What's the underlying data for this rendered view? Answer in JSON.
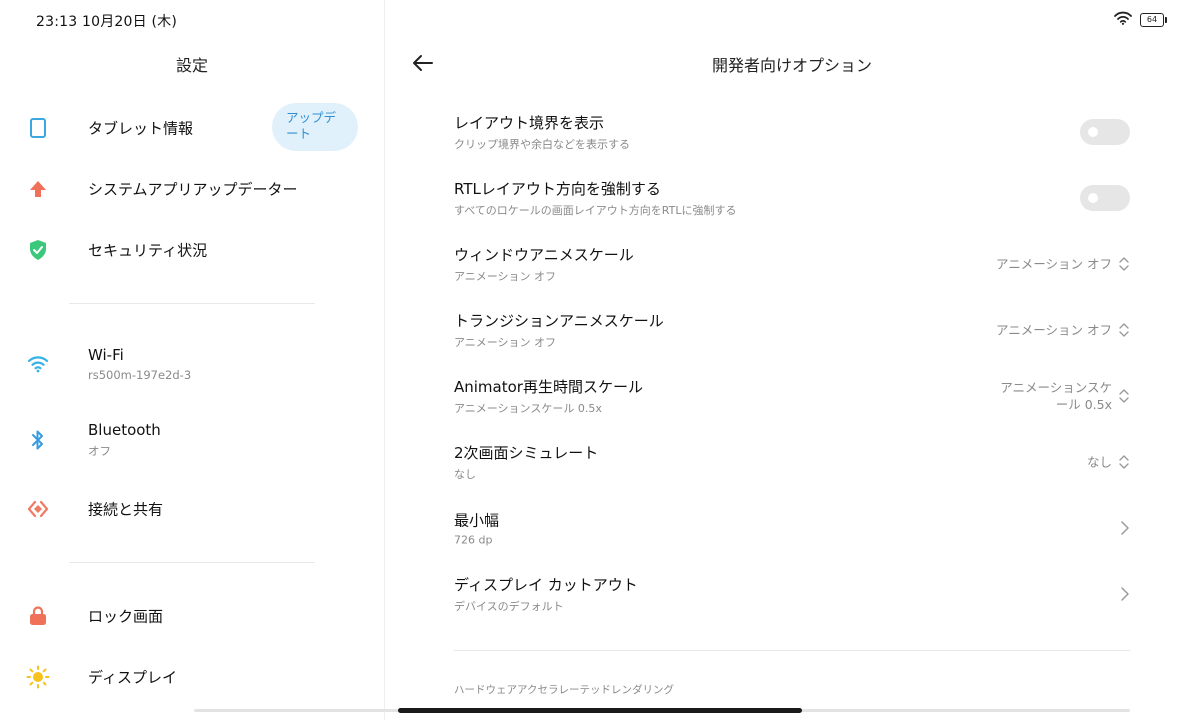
{
  "status_bar": {
    "time": "23:13  10月20日 (木)",
    "battery": "64"
  },
  "left": {
    "title": "設定",
    "update_badge": "アップデート",
    "items": [
      {
        "label": "タブレット情報",
        "sub": "",
        "icon": "tablet-icon"
      },
      {
        "label": "システムアプリアップデーター",
        "sub": "",
        "icon": "arrow-up-icon"
      },
      {
        "label": "セキュリティ状況",
        "sub": "",
        "icon": "shield-check-icon"
      },
      {
        "label": "Wi-Fi",
        "sub": "rs500m-197e2d-3",
        "icon": "wifi-icon"
      },
      {
        "label": "Bluetooth",
        "sub": "オフ",
        "icon": "bluetooth-icon"
      },
      {
        "label": "接続と共有",
        "sub": "",
        "icon": "share-icon"
      },
      {
        "label": "ロック画面",
        "sub": "",
        "icon": "lock-icon"
      },
      {
        "label": "ディスプレイ",
        "sub": "",
        "icon": "sun-icon"
      }
    ]
  },
  "right": {
    "title": "開発者向けオプション",
    "items": [
      {
        "label": "レイアウト境界を表示",
        "sub": "クリップ境界や余白などを表示する",
        "control": "toggle",
        "on": false
      },
      {
        "label": "RTLレイアウト方向を強制する",
        "sub": "すべてのロケールの画面レイアウト方向をRTLに強制する",
        "control": "toggle",
        "on": false
      },
      {
        "label": "ウィンドウアニメスケール",
        "sub": "アニメーション オフ",
        "value": "アニメーション オフ",
        "control": "select"
      },
      {
        "label": "トランジションアニメスケール",
        "sub": "アニメーション オフ",
        "value": "アニメーション オフ",
        "control": "select"
      },
      {
        "label": "Animator再生時間スケール",
        "sub": "アニメーションスケール 0.5x",
        "value": "アニメーションスケール 0.5x",
        "control": "select"
      },
      {
        "label": "2次画面シミュレート",
        "sub": "なし",
        "value": "なし",
        "control": "select"
      },
      {
        "label": "最小幅",
        "sub": "726 dp",
        "control": "chevron"
      },
      {
        "label": "ディスプレイ カットアウト",
        "sub": "デバイスのデフォルト",
        "control": "chevron"
      }
    ],
    "section_label": "ハードウェアアクセラレーテッドレンダリング"
  },
  "colors": {
    "accent_blue": "#2f8fd2",
    "update_bg": "#e1f1fb",
    "tablet": "#3aa7e0",
    "arrow_up": "#f0715a",
    "shield": "#3cc87a",
    "wifi": "#36b3e6",
    "bluetooth": "#3a9be0",
    "share": "#f07a62",
    "lock": "#f0715a",
    "sun": "#f6c21c"
  }
}
